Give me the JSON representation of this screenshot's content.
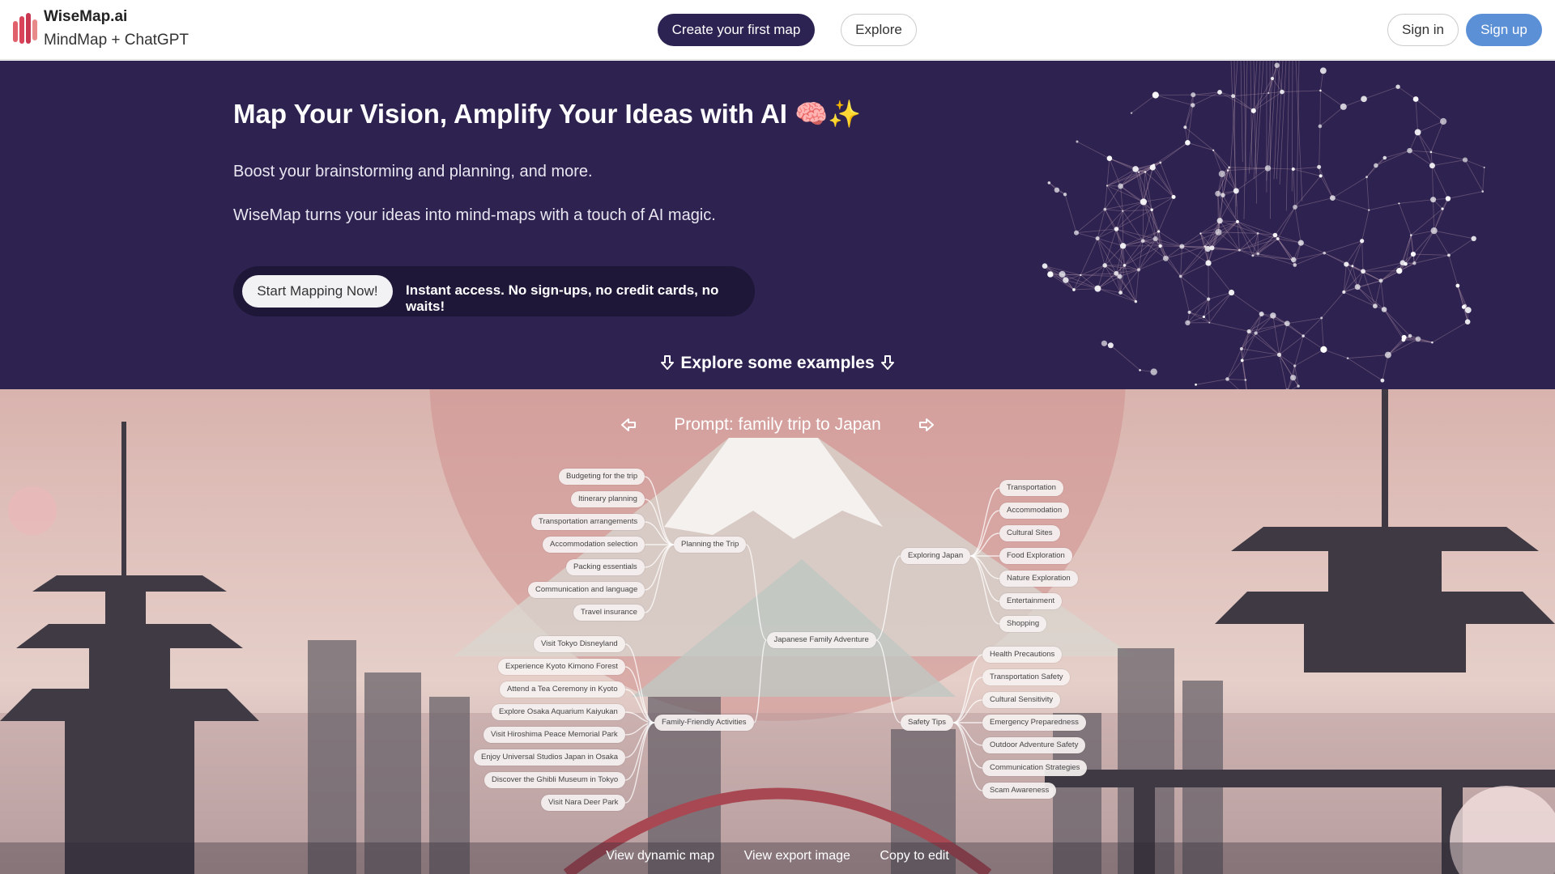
{
  "header": {
    "brand_name": "WiseMap.ai",
    "brand_sub": "MindMap + ChatGPT",
    "create_label": "Create your first map",
    "explore_label": "Explore",
    "signin_label": "Sign in",
    "signup_label": "Sign up"
  },
  "hero": {
    "title": "Map Your Vision, Amplify Your Ideas with AI 🧠✨",
    "subtitle1": "Boost your brainstorming and planning, and more.",
    "subtitle2": "WiseMap turns your ideas into mind-maps with a touch of AI magic.",
    "start_label": "Start Mapping Now!",
    "cta_text": "Instant access. No sign-ups, no credit cards, no waits!",
    "examples_label": "Explore some examples"
  },
  "showcase": {
    "prompt": "Prompt: family trip to Japan",
    "links": [
      "View dynamic map",
      "View export image",
      "Copy to edit"
    ]
  },
  "mindmap": {
    "root": "Japanese Family Adventure",
    "branches": [
      {
        "label": "Planning the Trip",
        "children": [
          "Budgeting for the trip",
          "Itinerary planning",
          "Transportation arrangements",
          "Accommodation selection",
          "Packing essentials",
          "Communication and language",
          "Travel insurance"
        ]
      },
      {
        "label": "Family-Friendly Activities",
        "children": [
          "Visit Tokyo Disneyland",
          "Experience Kyoto Kimono Forest",
          "Attend a Tea Ceremony in Kyoto",
          "Explore Osaka Aquarium Kaiyukan",
          "Visit Hiroshima Peace Memorial Park",
          "Enjoy Universal Studios Japan in Osaka",
          "Discover the Ghibli Museum in Tokyo",
          "Visit Nara Deer Park"
        ]
      },
      {
        "label": "Exploring Japan",
        "children": [
          "Transportation",
          "Accommodation",
          "Cultural Sites",
          "Food Exploration",
          "Nature Exploration",
          "Entertainment",
          "Shopping"
        ]
      },
      {
        "label": "Safety Tips",
        "children": [
          "Health Precautions",
          "Transportation Safety",
          "Cultural Sensitivity",
          "Emergency Preparedness",
          "Outdoor Adventure Safety",
          "Communication Strategies",
          "Scam Awareness"
        ]
      }
    ]
  }
}
